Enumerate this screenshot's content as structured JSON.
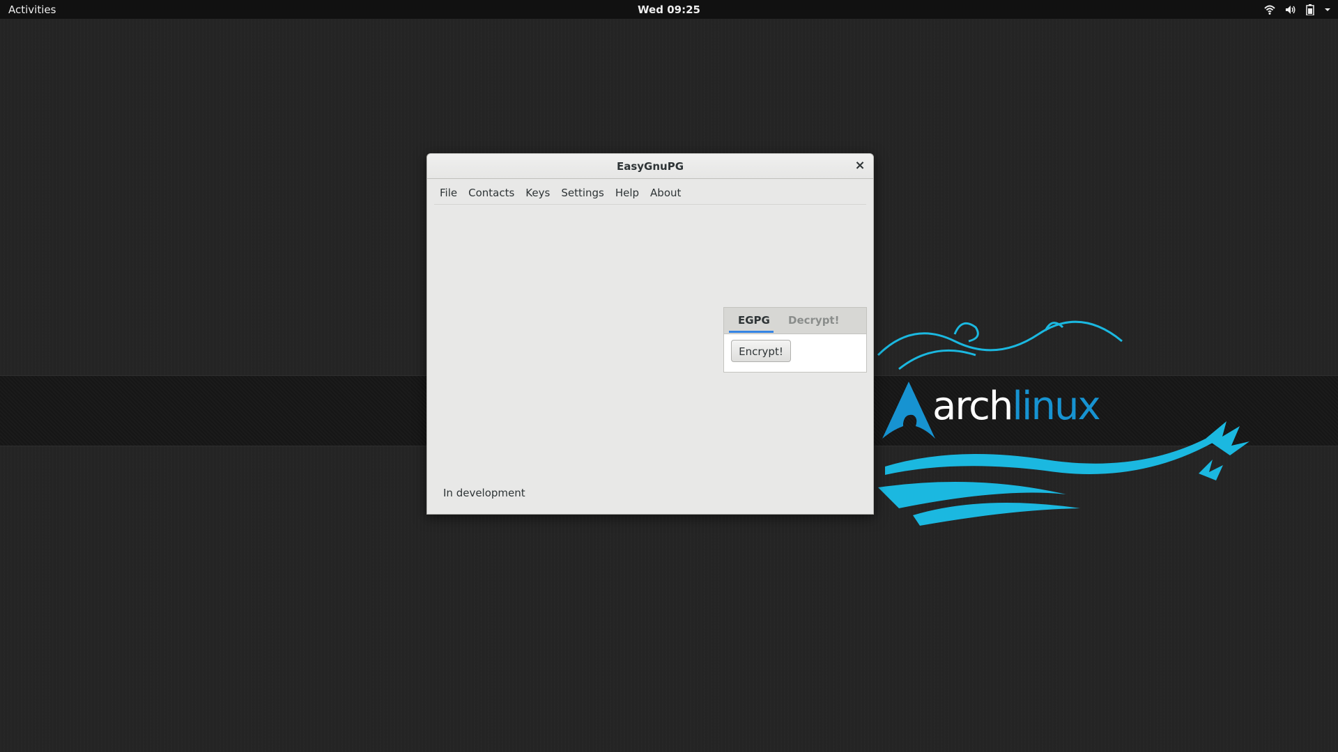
{
  "topbar": {
    "activities": "Activities",
    "clock": "Wed 09:25",
    "tray_icons": [
      "wifi-icon",
      "volume-icon",
      "battery-icon",
      "chevron-down-icon"
    ]
  },
  "wallpaper": {
    "logo_text_1": "arch",
    "logo_text_2": "linux",
    "accent_color": "#1793d1"
  },
  "window": {
    "title": "EasyGnuPG",
    "close_label": "×",
    "menu": [
      "File",
      "Contacts",
      "Keys",
      "Settings",
      "Help",
      "About"
    ],
    "tabs": [
      {
        "label": "EGPG",
        "active": true
      },
      {
        "label": "Decrypt!",
        "active": false
      }
    ],
    "encrypt_button": "Encrypt!",
    "status": "In development",
    "accent_color": "#3584e4"
  }
}
